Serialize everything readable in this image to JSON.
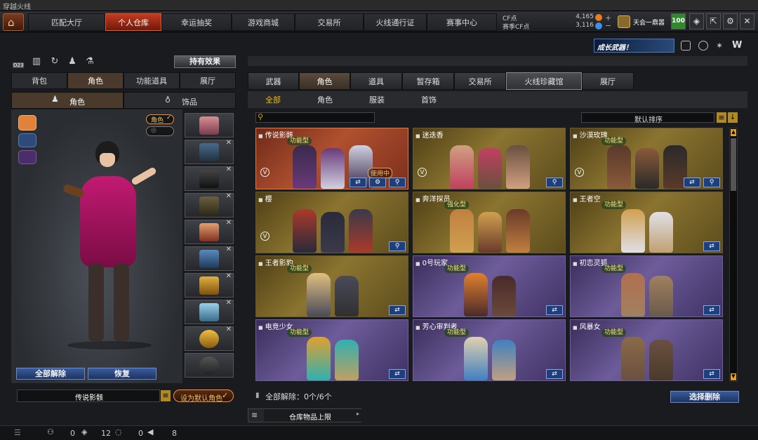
{
  "window": {
    "title": "穿越火线"
  },
  "topnav": {
    "tabs": [
      "匹配大厅",
      "个人仓库",
      "幸运抽奖",
      "游戏商城",
      "交易所",
      "火线通行证",
      "赛事中心"
    ],
    "active_tab": "个人仓库",
    "cf_label": "CF点",
    "cf_value": "4,165",
    "season_cf_label": "赛季CF点",
    "season_cf_value": "3,116",
    "clan_name": "天会一鼎嚣",
    "level": "100"
  },
  "left": {
    "counter_badge": "O23",
    "effects_button": "持有效果",
    "tabs": [
      "背包",
      "角色",
      "功能道具",
      "展厅"
    ],
    "active_tab": "角色",
    "subtabs": [
      "角色",
      "饰品"
    ],
    "role_tag": "角色",
    "btn_unequip_all": "全部解除",
    "btn_restore": "恢复",
    "current_role_name": "传说影骸",
    "btn_set_default": "设为默认角色"
  },
  "right": {
    "tabs": [
      "武器",
      "角色",
      "道具",
      "暂存箱",
      "交易所",
      "火线珍藏馆",
      "展厅"
    ],
    "active_tab": "角色",
    "categories": [
      "全部",
      "角色",
      "服装",
      "首饰"
    ],
    "active_category": "全部",
    "sort_label": "默认排序",
    "unequip_count_label": "全部解除：0个/6个",
    "select_delete_button": "选择删除",
    "storage_limit_label": "仓库物品上限",
    "cards": [
      {
        "name": "传说影骸",
        "theme": "red",
        "badge": "功能型",
        "using": "使用中"
      },
      {
        "name": "迷迭香",
        "theme": "gold",
        "badge": ""
      },
      {
        "name": "沙漠玫瑰",
        "theme": "gold",
        "badge": "功能型"
      },
      {
        "name": "樱",
        "theme": "gold",
        "badge": ""
      },
      {
        "name": "奔洋探员",
        "theme": "gold",
        "badge": "强化型"
      },
      {
        "name": "王者空",
        "theme": "gold",
        "badge": "功能型"
      },
      {
        "name": "王者影豹",
        "theme": "gold",
        "badge": "功能型"
      },
      {
        "name": "0号玩家",
        "theme": "purple",
        "badge": "功能型"
      },
      {
        "name": "初恋灵狐",
        "theme": "purple",
        "badge": "功能型"
      },
      {
        "name": "电竞少女",
        "theme": "purple",
        "badge": "功能型"
      },
      {
        "name": "芳心审判者",
        "theme": "purple",
        "badge": "功能型"
      },
      {
        "name": "风暴女",
        "theme": "purple",
        "badge": "功能型"
      }
    ]
  },
  "statusbar": {
    "friends_count": "0",
    "guild_count": "12",
    "chat_count": "0",
    "sound_count": "8"
  },
  "banner": {
    "text": "成长武器！"
  }
}
